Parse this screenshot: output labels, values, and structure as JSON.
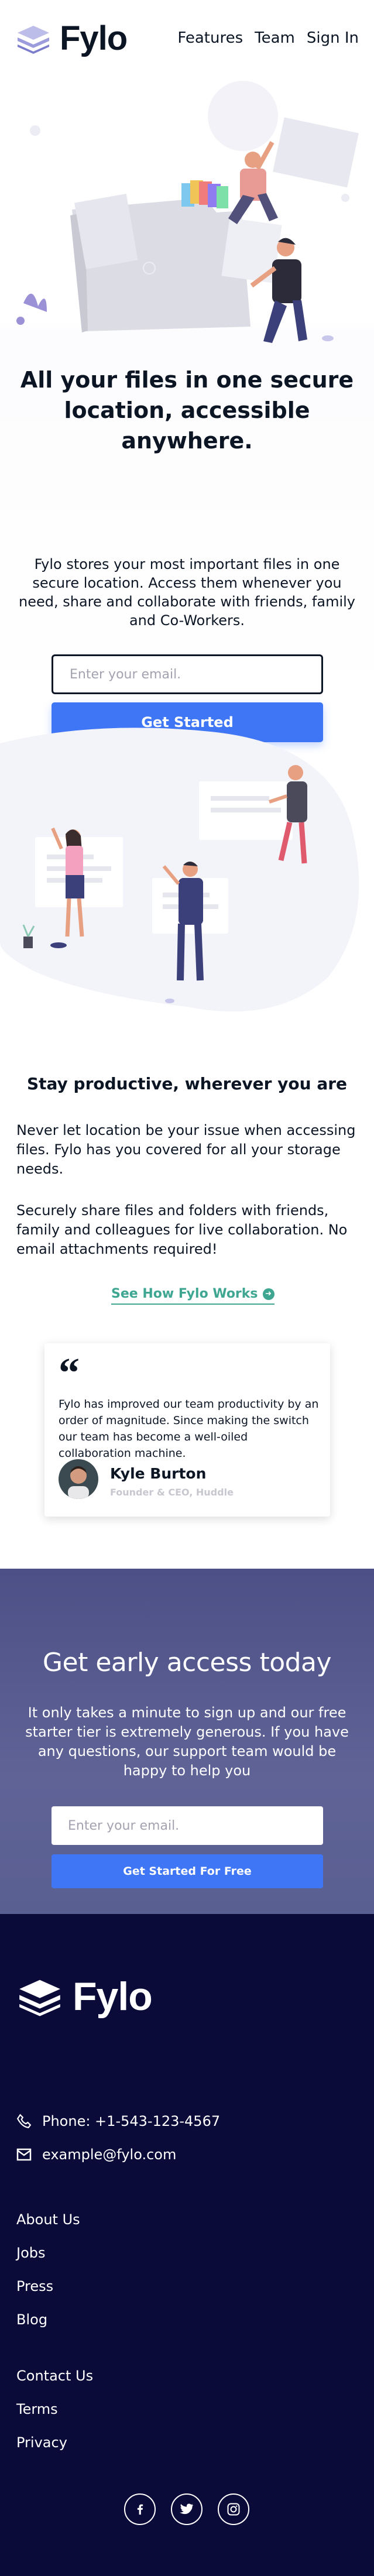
{
  "header": {
    "logo_text": "Fylo",
    "nav": [
      "Features",
      "Team",
      "Sign In"
    ]
  },
  "hero": {
    "title": "All your files in one secure location, accessible anywhere.",
    "text": "Fylo stores your most important files in one secure location. Access them whenever you need, share and collaborate with friends, family and Co-Workers.",
    "email_placeholder": "Enter your email.",
    "cta_label": "Get Started"
  },
  "productive": {
    "title": "Stay productive, wherever you are",
    "p1": "Never let location be your issue when accessing files. Fylo has you covered for all your storage needs.",
    "p2": "Securely share files and folders with friends, family and colleagues for live collaboration. No email attachments required!",
    "link_label": "See How Fylo Works"
  },
  "testimonial": {
    "text": "Fylo has improved our team productivity by an order of magnitude. Since making the switch our team has become a well-oiled collaboration machine.",
    "name": "Kyle Burton",
    "role": "Founder & CEO, Huddle"
  },
  "early_access": {
    "title": "Get early access today",
    "text": "It only takes a minute to sign up and our free starter tier is extremely generous. If you have any questions, our support team would be happy to help you",
    "email_placeholder": "Enter your email.",
    "cta_label": "Get Started For Free"
  },
  "footer": {
    "logo_text": "Fylo",
    "phone": "Phone: +1-543-123-4567",
    "email": "example@fylo.com",
    "links_col1": [
      "About Us",
      "Jobs",
      "Press",
      "Blog"
    ],
    "links_col2": [
      "Contact Us",
      "Terms",
      "Privacy"
    ],
    "social_icons": [
      "facebook-icon",
      "twitter-icon",
      "instagram-icon"
    ]
  },
  "colors": {
    "primary": "#3f76f5",
    "accent_green": "#3ea691",
    "dark_navy": "#0b0b3a",
    "early_bg": "#575b8f"
  }
}
